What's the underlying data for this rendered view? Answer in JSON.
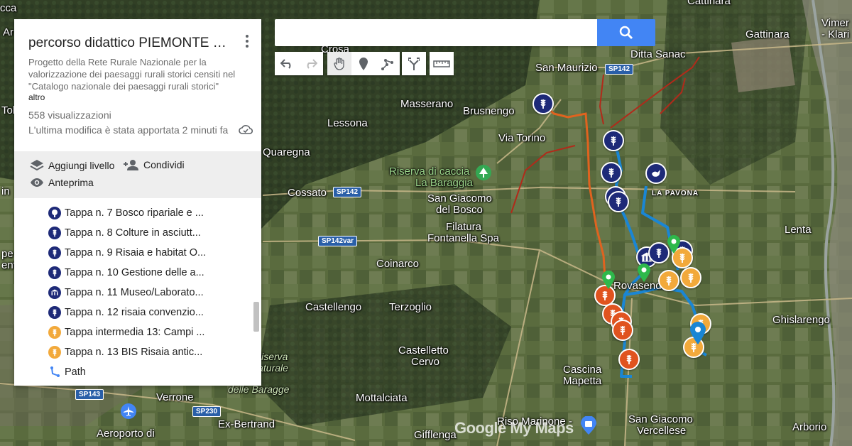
{
  "panel": {
    "title": "percorso didattico PIEMONTE Ba...",
    "description": "Progetto della Rete Rurale Nazionale per la valorizzazione dei paesaggi rurali storici censiti nel \"Catalogo nazionale dei paesaggi rurali storici\"",
    "more_label": "altro",
    "views": "558 visualizzazioni",
    "last_modified": "L'ultima modifica è stata apportata 2 minuti fa",
    "actions": {
      "add_layer": "Aggiungi livello",
      "share": "Condividi",
      "preview": "Anteprima"
    },
    "items": [
      {
        "label": "Tappa n. 7 Bosco ripariale e ...",
        "icon": "tree-icon",
        "color": "#1e2a78"
      },
      {
        "label": "Tappa n. 8 Colture in asciutt...",
        "icon": "wheat-icon",
        "color": "#1e2a78"
      },
      {
        "label": "Tappa n. 9 Risaia e habitat O...",
        "icon": "wheat-icon",
        "color": "#1e2a78"
      },
      {
        "label": "Tappa n. 10 Gestione delle a...",
        "icon": "wheat-icon",
        "color": "#1e2a78"
      },
      {
        "label": "Tappa n. 11 Museo/Laborato...",
        "icon": "museum-icon",
        "color": "#1e2a78"
      },
      {
        "label": "Tappa n. 12 risaia convenzio...",
        "icon": "wheat-icon",
        "color": "#1e2a78"
      },
      {
        "label": "Tappa intermedia 13: Campi ...",
        "icon": "wheat-icon",
        "color": "#f2a93b"
      },
      {
        "label": "Tappa n. 13 BIS Risaia antic...",
        "icon": "wheat-icon",
        "color": "#f2a93b"
      },
      {
        "label": "Path",
        "icon": "path-icon",
        "color": "#4285f4"
      }
    ]
  },
  "search": {
    "placeholder": ""
  },
  "toolbar": [
    "undo-icon",
    "redo-icon",
    "hand-icon",
    "marker-icon",
    "draw-line-icon",
    "directions-icon",
    "ruler-icon"
  ],
  "map": {
    "places": {
      "crosa": "Crosa",
      "gattinara": "Gattinara",
      "ditta_sanac": "Ditta Sanac",
      "san_maurizio": "San Maurizio",
      "masserano": "Masserano",
      "brusnengo": "Brusnengo",
      "lessona": "Lessona",
      "via_torino": "Via Torino",
      "quaregna": "Quaregna",
      "riserva1": "Riserva di caccia",
      "riserva2": "La Baraggia",
      "cossato": "Cossato",
      "san_giacomo1": "San Giacomo",
      "san_giacomo2": "del Bosco",
      "la_pavona": "LA PAVONA",
      "filatura1": "Filatura",
      "filatura2": "Fontanella Spa",
      "lenta": "Lenta",
      "coinarco": "Coinarco",
      "castellengo": "Castellengo",
      "terzoglio": "Terzoglio",
      "ghislarengo": "Ghislarengo",
      "castelletto1": "Castelletto",
      "castelletto2": "Cervo",
      "riserva_n1": "Riserva",
      "riserva_n2": "Naturale",
      "riserva_n3": "delle Baragge",
      "cascina1": "Cascina",
      "cascina2": "Mapetta",
      "verrone": "Verrone",
      "mottalciata": "Mottalciata",
      "exbertrand": "Ex-Bertrand",
      "aeroporto": "Aeroporto di",
      "gifflenga": "Gifflenga",
      "riso1": "Riso Marinone -",
      "sgv1": "San Giacomo",
      "sgv2": "Vercellese",
      "arborio": "Arborio",
      "rovasenda": "Rovasenda",
      "vimer1": "Vimer",
      "vimer2": "- Klari",
      "cattinara": "Cattinara",
      "cca": "cca",
      "left1": "Ar",
      "left2": "Tol",
      "left3": "in",
      "left4": "pe",
      "left5": "enf"
    },
    "roads": {
      "sp142a": "SP142",
      "sp142b": "SP142",
      "sp142var": "SP142var",
      "sp143": "SP143",
      "sp230": "SP230"
    },
    "watermark": "Google My Maps"
  },
  "colors": {
    "accent": "#4285f4",
    "navy": "#1e2a78",
    "orange": "#e0531f",
    "amber": "#f2a93b",
    "route_blue": "#1a86d4",
    "route_orange": "#e0631f",
    "route_red": "#b12a1a"
  }
}
